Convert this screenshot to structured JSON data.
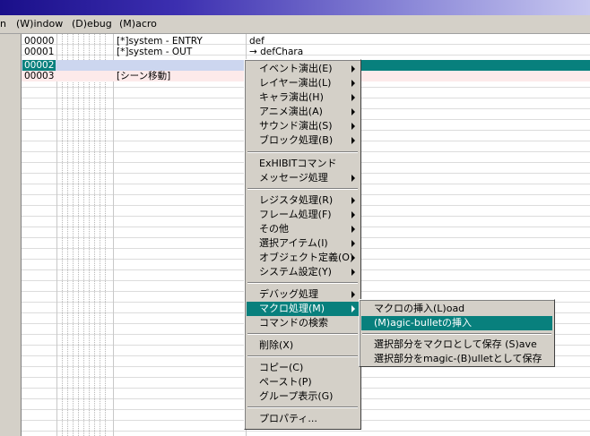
{
  "menubar": {
    "items": [
      {
        "label": "n"
      },
      {
        "label": "(W)indow"
      },
      {
        "label": "(D)ebug"
      },
      {
        "label": "(M)acro"
      }
    ]
  },
  "table": {
    "rows": [
      {
        "num": "00000",
        "cmd": "[*]system -  ENTRY",
        "arg": "def"
      },
      {
        "num": "00001",
        "cmd": "[*]system -  OUT",
        "arg": "→ defChara"
      },
      {
        "num": "00002",
        "cmd": "",
        "arg": ""
      },
      {
        "num": "00003",
        "cmd": "[シーン移動]",
        "arg": ""
      }
    ]
  },
  "context_menu": {
    "items": [
      "イベント演出(E)",
      "レイヤー演出(L)",
      "キャラ演出(H)",
      "アニメ演出(A)",
      "サウンド演出(S)",
      "ブロック処理(B)",
      "ExHIBITコマンド",
      "メッセージ処理",
      "レジスタ処理(R)",
      "フレーム処理(F)",
      "その他",
      "選択アイテム(I)",
      "オブジェクト定義(O)",
      "システム設定(Y)",
      "デバッグ処理",
      "マクロ処理(M)",
      "コマンドの検索",
      "削除(X)",
      "コピー(C)",
      "ペースト(P)",
      "グループ表示(G)",
      "プロパティ..."
    ]
  },
  "submenu": {
    "items": [
      "マクロの挿入(L)oad",
      "(M)agic-bulletの挿入",
      "選択部分をマクロとして保存 (S)ave",
      "選択部分をmagic-(B)ulletとして保存"
    ]
  }
}
